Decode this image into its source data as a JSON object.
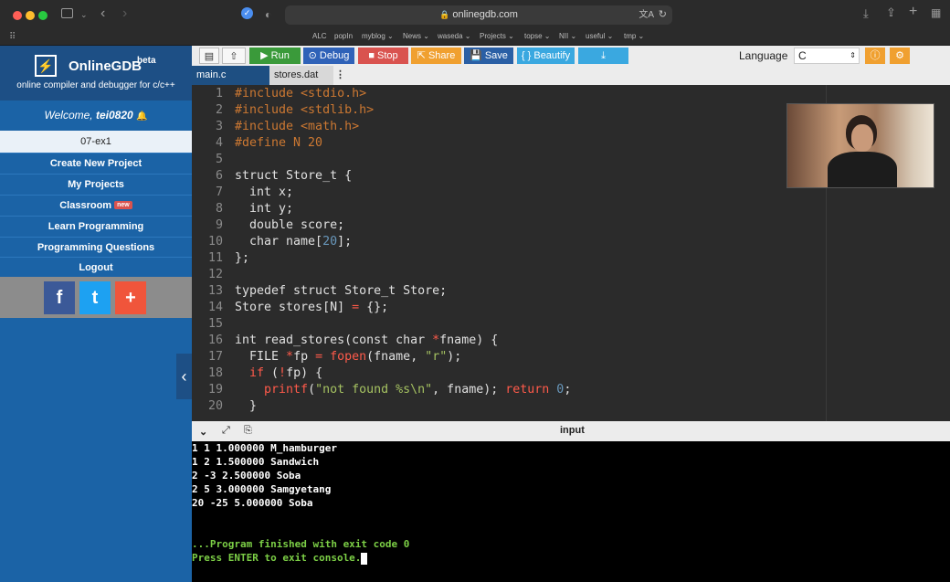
{
  "browser": {
    "url": "onlinegdb.com",
    "bookmarks": [
      "ALC",
      "popIn",
      "myblog ⌄",
      "News ⌄",
      "waseda ⌄",
      "Projects ⌄",
      "topse ⌄",
      "NII ⌄",
      "useful ⌄",
      "tmp ⌄"
    ]
  },
  "sidebar": {
    "brand": "OnlineGDB",
    "beta": "beta",
    "tagline": "online compiler and debugger for c/c++",
    "welcome_prefix": "Welcome,",
    "username": "tei0820",
    "project_name": "07-ex1",
    "items": [
      {
        "label": "Create New Project"
      },
      {
        "label": "My Projects"
      },
      {
        "label": "Classroom",
        "badge": "new"
      },
      {
        "label": "Learn Programming"
      },
      {
        "label": "Programming Questions"
      },
      {
        "label": "Logout"
      }
    ],
    "social": [
      "f",
      "t",
      "+"
    ]
  },
  "toolbar": {
    "run": "Run",
    "debug": "Debug",
    "stop": "Stop",
    "share": "Share",
    "save": "Save",
    "beautify": "{ } Beautify",
    "language_label": "Language",
    "language_value": "C"
  },
  "tabs": [
    "main.c",
    "stores.dat"
  ],
  "code_lines": [
    "1",
    "2",
    "3",
    "4",
    "5",
    "6",
    "7",
    "8",
    "9",
    "10",
    "11",
    "12",
    "13",
    "14",
    "15",
    "16",
    "17",
    "18",
    "19",
    "20"
  ],
  "code": {
    "l1": "#include <stdio.h>",
    "l2": "#include <stdlib.h>",
    "l3": "#include <math.h>",
    "l4": "#define N 20",
    "l6": "struct Store_t {",
    "l7": "  int x;",
    "l8": "  int y;",
    "l9": "  double score;",
    "l10a": "  char name[",
    "l10b": "20",
    "l10c": "];",
    "l11": "};",
    "l13": "typedef struct Store_t Store;",
    "l14a": "Store stores[N] ",
    "l14b": "=",
    "l14c": " {};",
    "l16a": "int read_stores(const char ",
    "l16b": "*",
    "l16c": "fname) {",
    "l17a": "  FILE ",
    "l17b": "*",
    "l17c": "fp ",
    "l17d": "=",
    "l17e": " fopen",
    "l17f": "(fname, ",
    "l17g": "\"r\"",
    "l17h": ");",
    "l18a": "  if",
    "l18b": " (",
    "l18c": "!",
    "l18d": "fp) {",
    "l19a": "    printf",
    "l19b": "(",
    "l19c": "\"not found %s\\n\"",
    "l19d": ", fname); ",
    "l19e": "return",
    "l19f": " ",
    "l19g": "0",
    "l19h": ";",
    "l20": "  }"
  },
  "console": {
    "title": "input",
    "lines": [
      "1 1 1.000000 M_hamburger",
      "1 2 1.500000 Sandwich",
      "2 -3 2.500000 Soba",
      "2 5 3.000000 Samgyetang",
      "20 -25 5.000000 Soba"
    ],
    "finished": "...Program finished with exit code 0",
    "press": "Press ENTER to exit console."
  },
  "colors": {
    "sidebar": "#1b63a6",
    "run": "#3a9a3a",
    "debug": "#2f62b8",
    "stop": "#d9534f",
    "share": "#f0a030",
    "save": "#2a5fa5",
    "beautify": "#3aa8e0",
    "download": "#3aa8e0"
  }
}
